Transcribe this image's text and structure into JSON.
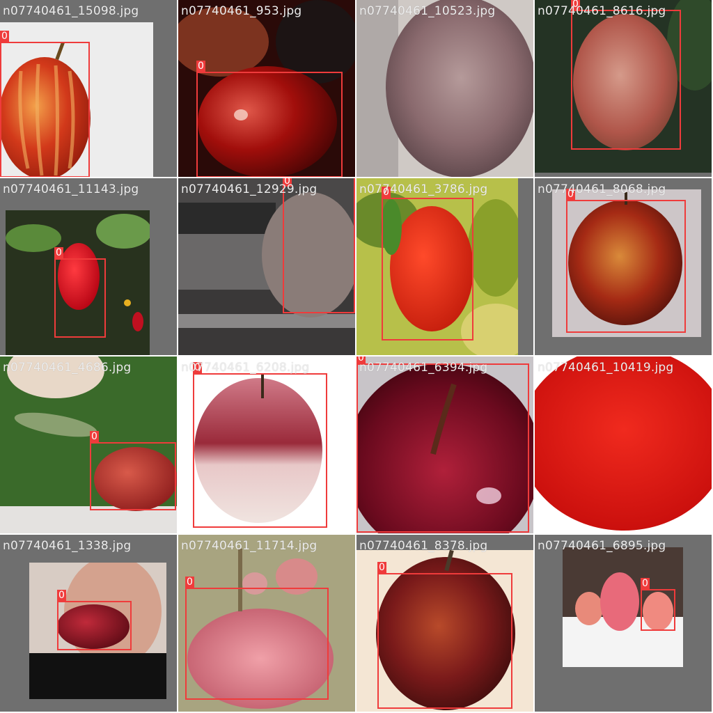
{
  "colors": {
    "box": "#ef3b3b",
    "label_text": "#ffffff",
    "filename_text": "#ececec",
    "tile_background": "#6f6f6f"
  },
  "tiles": [
    {
      "filename": "n07740461_15098.jpg",
      "boxes": [
        {
          "label": "0"
        }
      ]
    },
    {
      "filename": "n07740461_953.jpg",
      "boxes": [
        {
          "label": "0"
        }
      ]
    },
    {
      "filename": "n07740461_10523.jpg",
      "boxes": []
    },
    {
      "filename": "n07740461_8616.jpg",
      "boxes": [
        {
          "label": "0"
        }
      ]
    },
    {
      "filename": "n07740461_11143.jpg",
      "boxes": [
        {
          "label": "0"
        }
      ]
    },
    {
      "filename": "n07740461_12929.jpg",
      "boxes": [
        {
          "label": "0"
        }
      ]
    },
    {
      "filename": "n07740461_3786.jpg",
      "boxes": [
        {
          "label": "0"
        }
      ]
    },
    {
      "filename": "n07740461_8068.jpg",
      "boxes": [
        {
          "label": "0"
        }
      ]
    },
    {
      "filename": "n07740461_4686.jpg",
      "boxes": [
        {
          "label": "0"
        }
      ]
    },
    {
      "filename": "n07740461_6208.jpg",
      "boxes": [
        {
          "label": "0"
        }
      ]
    },
    {
      "filename": "n07740461_6394.jpg",
      "boxes": [
        {
          "label": "0"
        }
      ]
    },
    {
      "filename": "n07740461_10419.jpg",
      "boxes": []
    },
    {
      "filename": "n07740461_1338.jpg",
      "boxes": [
        {
          "label": "0"
        }
      ]
    },
    {
      "filename": "n07740461_11714.jpg",
      "boxes": [
        {
          "label": "0"
        }
      ]
    },
    {
      "filename": "n07740461_8378.jpg",
      "boxes": [
        {
          "label": "0"
        }
      ]
    },
    {
      "filename": "n07740461_6895.jpg",
      "boxes": [
        {
          "label": "0"
        }
      ]
    }
  ]
}
